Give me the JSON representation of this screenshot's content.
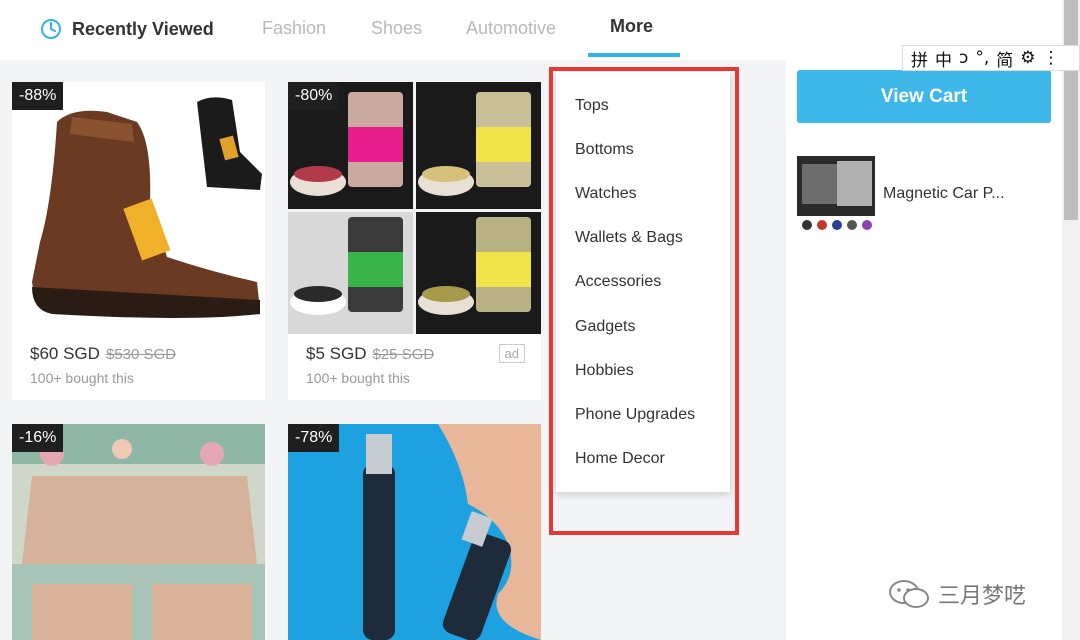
{
  "nav": {
    "recent": "Recently Viewed",
    "tabs": [
      "Fashion",
      "Shoes",
      "Automotive",
      "More"
    ]
  },
  "products": [
    {
      "discount": "-88%",
      "price": "$60 SGD",
      "old_price": "$530 SGD",
      "bought": "100+ bought this",
      "ad": ""
    },
    {
      "discount": "-80%",
      "price": "$5 SGD",
      "old_price": "$25 SGD",
      "bought": "100+ bought this",
      "ad": "ad"
    },
    {
      "discount": "-16%"
    },
    {
      "discount": "-78%"
    }
  ],
  "more_menu": [
    "Tops",
    "Bottoms",
    "Watches",
    "Wallets & Bags",
    "Accessories",
    "Gadgets",
    "Hobbies",
    "Phone Upgrades",
    "Home Decor"
  ],
  "cart": {
    "button": "View Cart",
    "item_name": "Magnetic Car P..."
  },
  "ime": [
    "拼",
    "中",
    "ɔ",
    "°,",
    "简",
    "⚙",
    "⋮"
  ],
  "watermark": "三月梦呓",
  "colors": {
    "accent": "#2fb4e6",
    "cart_button": "#3db8e8",
    "highlight": "#e53935"
  }
}
